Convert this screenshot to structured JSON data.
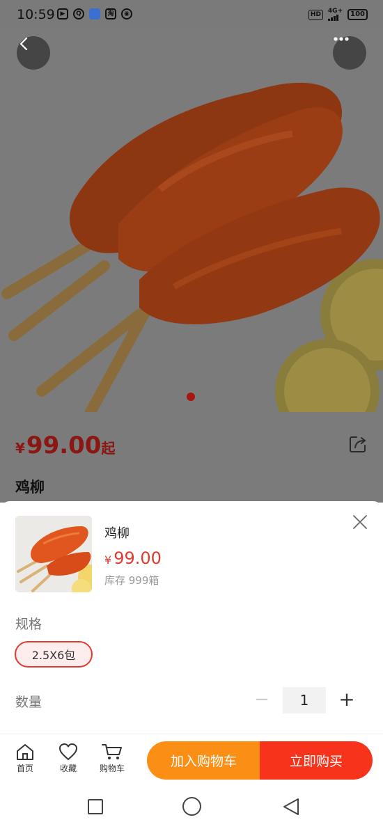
{
  "status_bar": {
    "time": "10:59",
    "network": "4G+",
    "hd": "HD",
    "battery": "100",
    "icons": [
      "play-icon",
      "q-icon",
      "bilibili-icon",
      "taobao-icon",
      "bot-icon"
    ]
  },
  "product": {
    "price_symbol": "¥",
    "price": "99.00",
    "price_suffix": "起",
    "title": "鸡柳"
  },
  "sheet": {
    "name": "鸡柳",
    "price_symbol": "¥",
    "price": "99.00",
    "stock": "库存 999箱",
    "spec_label": "规格",
    "spec_option": "2.5X6包",
    "qty_label": "数量",
    "qty_minus": "−",
    "qty_value": "1",
    "qty_plus": "+"
  },
  "action_bar": {
    "home_label": "首页",
    "fav_label": "收藏",
    "cart_label": "购物车",
    "add_to_cart": "加入购物车",
    "buy_now": "立即购买"
  },
  "colors": {
    "accent_red": "#e13a2c",
    "cart_orange": "#fb8f16",
    "buy_red": "#f7331c"
  }
}
